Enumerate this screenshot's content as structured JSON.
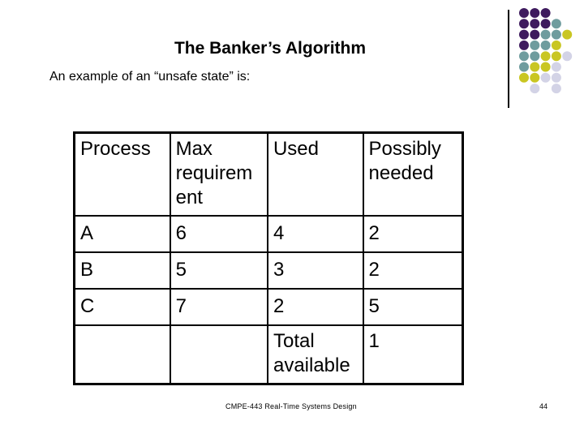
{
  "slide": {
    "title": "The Banker’s Algorithm",
    "subtitle": "An example of an “unsafe state” is:"
  },
  "table": {
    "headers": [
      "Process",
      "Max requirem ent",
      "Used",
      "Possibly needed"
    ],
    "rows": [
      [
        "A",
        "6",
        "4",
        "2"
      ],
      [
        "B",
        "5",
        "3",
        "2"
      ],
      [
        "C",
        "7",
        "2",
        "5"
      ]
    ],
    "total_row": [
      "",
      "",
      "Total available",
      "1"
    ]
  },
  "footer": {
    "course": "CMPE-443 Real-Time Systems Design",
    "page_number": "44"
  },
  "decoration": {
    "colors": {
      "P": "#3e1a5e",
      "T": "#6f9c9e",
      "Y": "#c9c622",
      "L": "#d3d3e6"
    },
    "dot_pattern": [
      "PPP",
      "PPPT",
      "PPTTY",
      "PTTY",
      "TTYYL",
      "TYYL",
      "YYLL",
      "_L_L"
    ]
  }
}
